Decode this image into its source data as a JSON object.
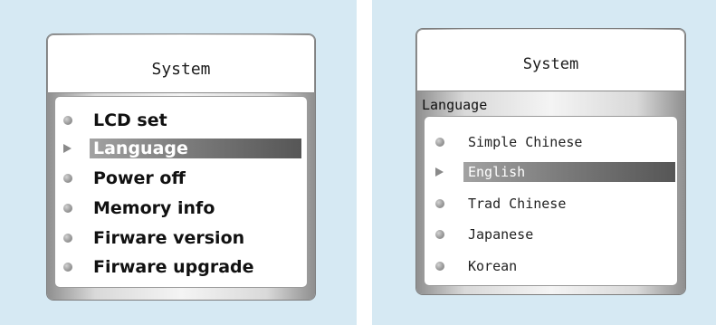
{
  "left_screen": {
    "title": "System",
    "items": [
      {
        "label": "LCD set",
        "selected": false
      },
      {
        "label": "Language",
        "selected": true
      },
      {
        "label": "Power off",
        "selected": false
      },
      {
        "label": "Memory info",
        "selected": false
      },
      {
        "label": "Firware version",
        "selected": false
      },
      {
        "label": "Firware upgrade",
        "selected": false
      }
    ]
  },
  "right_screen": {
    "title": "System",
    "section": "Language",
    "items": [
      {
        "label": "Simple Chinese",
        "selected": false
      },
      {
        "label": "English",
        "selected": true
      },
      {
        "label": "Trad Chinese",
        "selected": false
      },
      {
        "label": "Japanese",
        "selected": false
      },
      {
        "label": "Korean",
        "selected": false
      }
    ]
  },
  "colors": {
    "background": "#d6e9f3",
    "highlight": "#7c7c7c",
    "bullet": "#9a9a9a"
  }
}
